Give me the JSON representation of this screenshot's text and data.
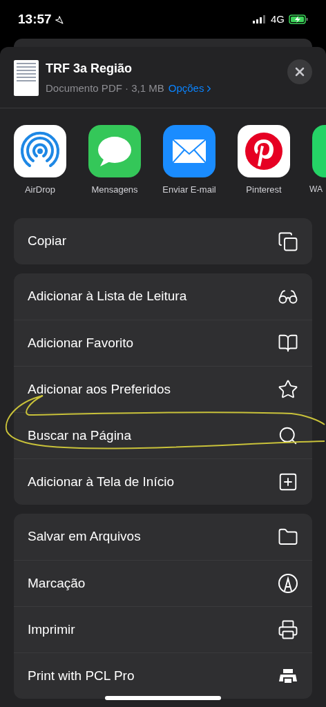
{
  "status_bar": {
    "time": "13:57",
    "network": "4G"
  },
  "share_sheet": {
    "title": "TRF 3a Região",
    "subtitle": "Documento PDF · 3,1 MB",
    "options_link": "Opções"
  },
  "apps": [
    {
      "label": "AirDrop"
    },
    {
      "label": "Mensagens"
    },
    {
      "label": "Enviar E-mail"
    },
    {
      "label": "Pinterest"
    },
    {
      "label": "WA"
    }
  ],
  "action_groups": [
    {
      "actions": [
        {
          "label": "Copiar",
          "highlighted": false
        }
      ]
    },
    {
      "actions": [
        {
          "label": "Adicionar à Lista de Leitura",
          "highlighted": false
        },
        {
          "label": "Adicionar Favorito",
          "highlighted": false
        },
        {
          "label": "Adicionar aos Preferidos",
          "highlighted": false
        },
        {
          "label": "Buscar na Página",
          "highlighted": true
        },
        {
          "label": "Adicionar à Tela de Início",
          "highlighted": false
        }
      ]
    },
    {
      "actions": [
        {
          "label": "Salvar em Arquivos",
          "highlighted": false
        },
        {
          "label": "Marcação",
          "highlighted": false
        },
        {
          "label": "Imprimir",
          "highlighted": false
        },
        {
          "label": "Print with PCL Pro",
          "highlighted": false
        }
      ]
    }
  ]
}
